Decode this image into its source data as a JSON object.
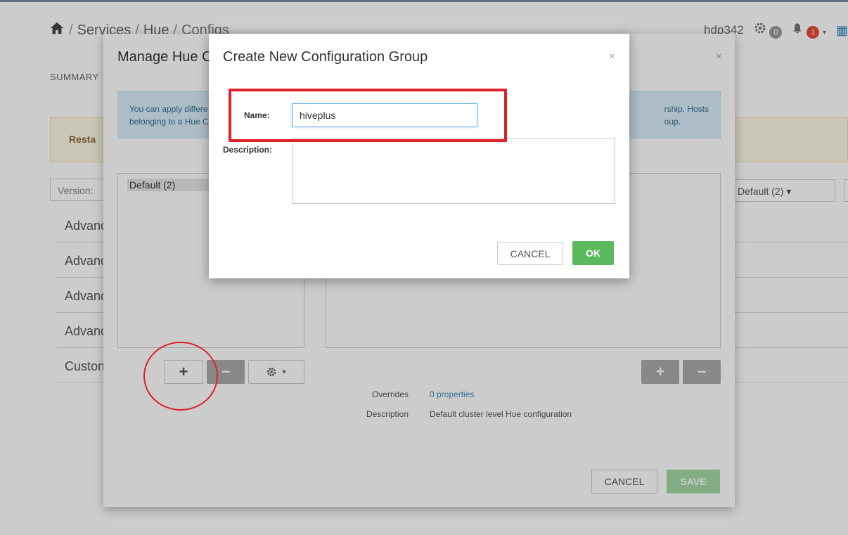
{
  "breadcrumb": {
    "items": [
      "Services",
      "Hue",
      "Configs"
    ]
  },
  "topbar": {
    "cluster_name": "hdp342",
    "ops_count": "0",
    "alerts_count": "1"
  },
  "background": {
    "summary_tab": "SUMMARY",
    "restart_label": "Resta",
    "version_label": "Version:",
    "rows": [
      "Advanc",
      "Advanc",
      "Advanc",
      "Advanc",
      "Custon"
    ],
    "group_select": "Default (2)"
  },
  "manage_modal": {
    "title": "Manage Hue C",
    "info_line1": "You can apply differe",
    "info_line2": "belonging to a Hue Co",
    "info_right1": "rship. Hosts",
    "info_right2": "oup.",
    "groups": [
      "Default (2)"
    ],
    "overrides_label": "Overrides",
    "overrides_value": "0 properties",
    "description_label": "Description",
    "description_value": "Default cluster level Hue configuration",
    "cancel_label": "CANCEL",
    "save_label": "SAVE"
  },
  "create_modal": {
    "title": "Create New Configuration Group",
    "name_label": "Name:",
    "name_value": "hiveplus",
    "description_label": "Description:",
    "description_value": "",
    "cancel_label": "CANCEL",
    "ok_label": "OK"
  },
  "colors": {
    "annotation": "#e0202a",
    "ok_button": "#5cb85c",
    "save_button_disabled": "#a3d9a5"
  }
}
